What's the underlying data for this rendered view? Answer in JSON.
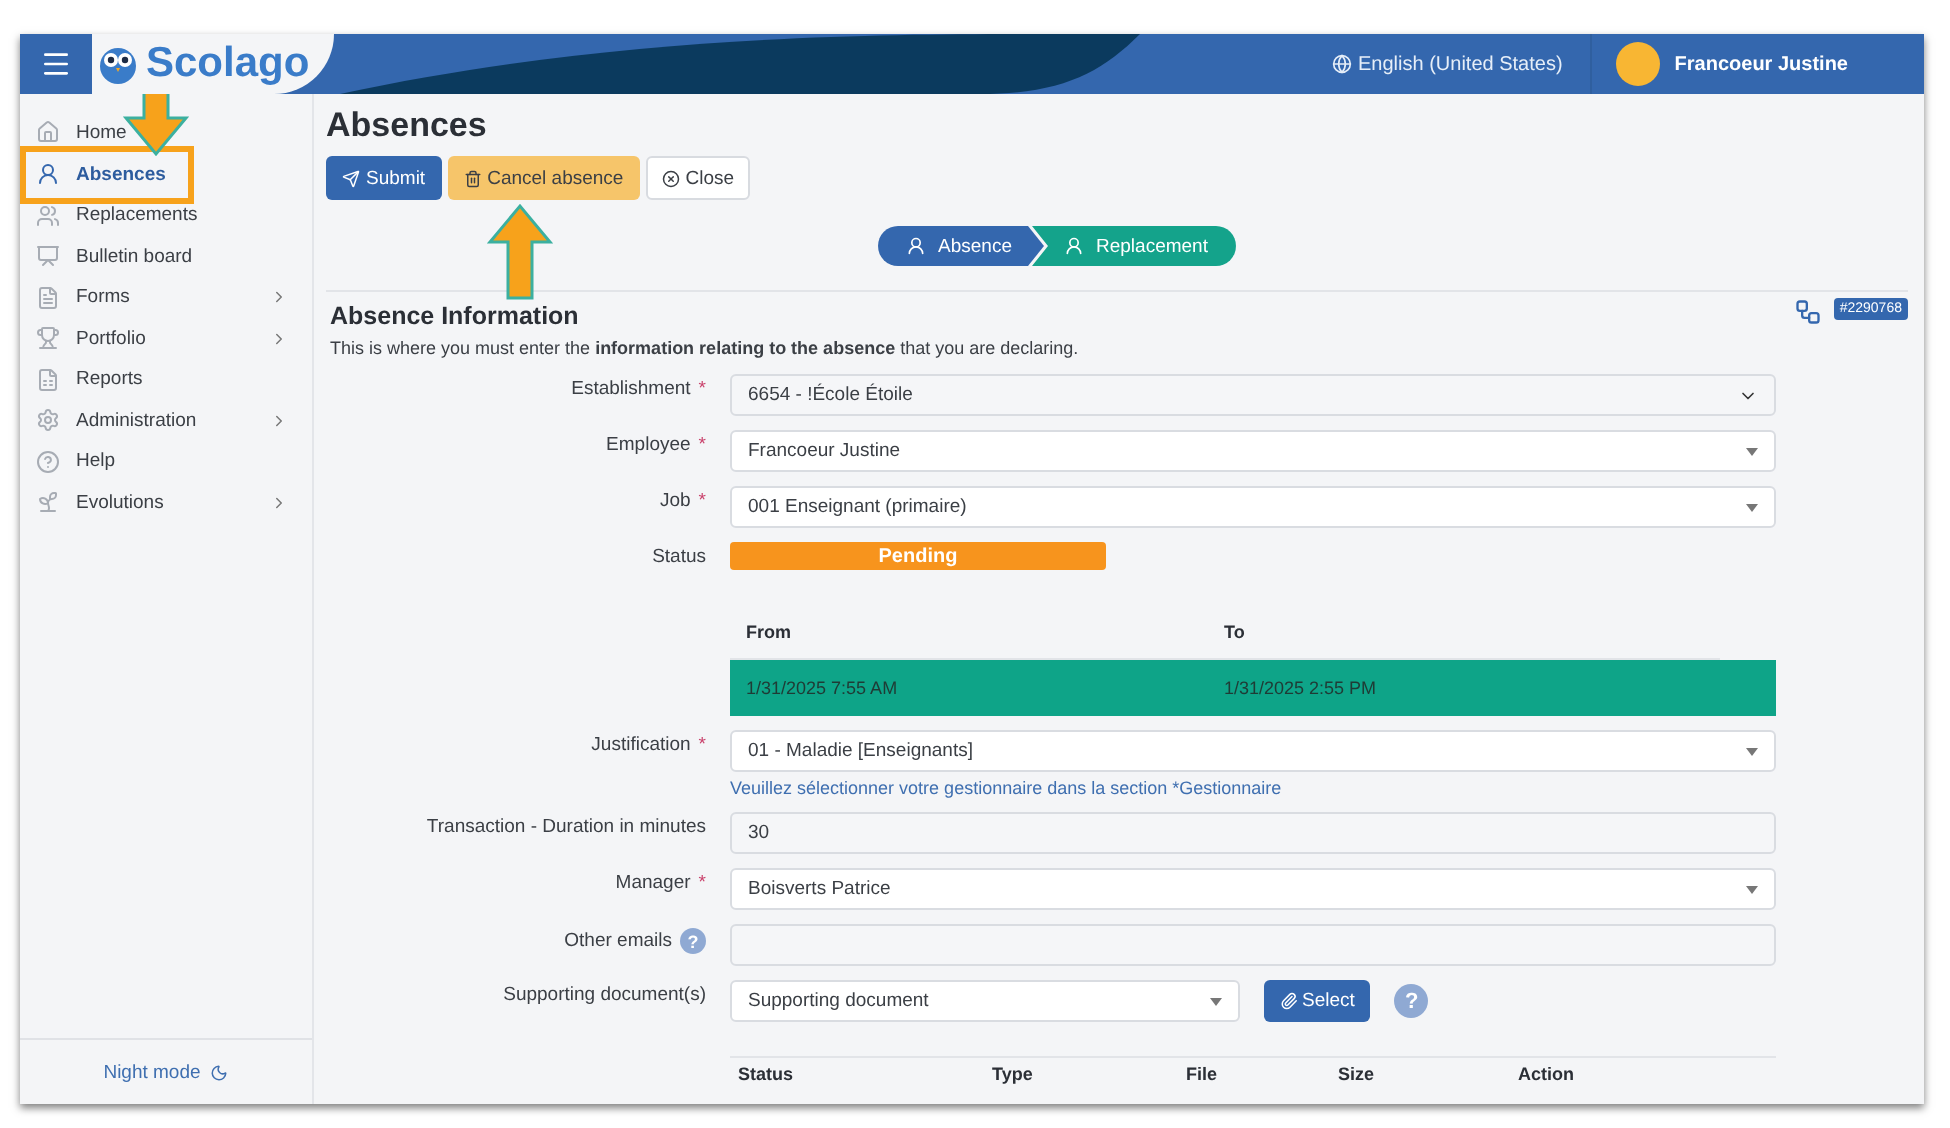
{
  "header": {
    "logo_text": "Scolago",
    "language": "English (United States)",
    "user": "Francoeur Justine"
  },
  "sidebar": {
    "items": [
      {
        "label": "Home",
        "selected": false,
        "has_children": false
      },
      {
        "label": "Absences",
        "selected": true,
        "has_children": false
      },
      {
        "label": "Replacements",
        "selected": false,
        "has_children": false
      },
      {
        "label": "Bulletin board",
        "selected": false,
        "has_children": false
      },
      {
        "label": "Forms",
        "selected": false,
        "has_children": true
      },
      {
        "label": "Portfolio",
        "selected": false,
        "has_children": true
      },
      {
        "label": "Reports",
        "selected": false,
        "has_children": false
      },
      {
        "label": "Administration",
        "selected": false,
        "has_children": true
      },
      {
        "label": "Help",
        "selected": false,
        "has_children": false
      },
      {
        "label": "Evolutions",
        "selected": false,
        "has_children": true
      }
    ],
    "night_mode": "Night mode"
  },
  "page": {
    "title": "Absences",
    "actions": [
      {
        "label": "Submit",
        "kind": "primary"
      },
      {
        "label": "Cancel absence",
        "kind": "warning"
      },
      {
        "label": "Close",
        "kind": "default"
      }
    ]
  },
  "steps": [
    {
      "label": "Absence",
      "color": "#3467ae"
    },
    {
      "label": "Replacement",
      "color": "#14a38b"
    }
  ],
  "section": {
    "title": "Absence Information",
    "intro": "This is where you must enter the **information relating to the absence** that you are declaring.",
    "ticket": "#2290768"
  },
  "fields": [
    {
      "kind": "native-select",
      "label": "Establishment",
      "required_mark": "*",
      "value": "6654 - !École Étoile"
    },
    {
      "kind": "select",
      "label": "Employee",
      "required_mark": "*",
      "value": "Francoeur Justine"
    },
    {
      "kind": "select",
      "label": "Job",
      "required_mark": "*",
      "value": "001 Enseignant (primaire)"
    },
    {
      "kind": "status",
      "label": "Status",
      "value": "Pending"
    },
    {
      "kind": "period",
      "from_label": "From",
      "to_label": "To",
      "from": "1/31/2025 7:55 AM",
      "to": "1/31/2025 2:55 PM"
    },
    {
      "kind": "select",
      "label": "Justification",
      "required_mark": "*",
      "value": "01 - Maladie [Enseignants]",
      "hint": "Veuillez sélectionner votre gestionnaire dans la section *Gestionnaire"
    },
    {
      "kind": "text",
      "label": "Transaction - Duration in minutes",
      "value": "30"
    },
    {
      "kind": "select",
      "label": "Manager",
      "required_mark": "*",
      "value": "Boisverts Patrice"
    },
    {
      "kind": "text",
      "label": "Other emails",
      "help": "?"
    },
    {
      "kind": "document",
      "label": "Supporting document(s)",
      "value": "Supporting document",
      "button": "Select",
      "help": "?"
    }
  ],
  "documents_table": {
    "columns": [
      "Status",
      "Type",
      "File",
      "Size",
      "Action"
    ]
  }
}
